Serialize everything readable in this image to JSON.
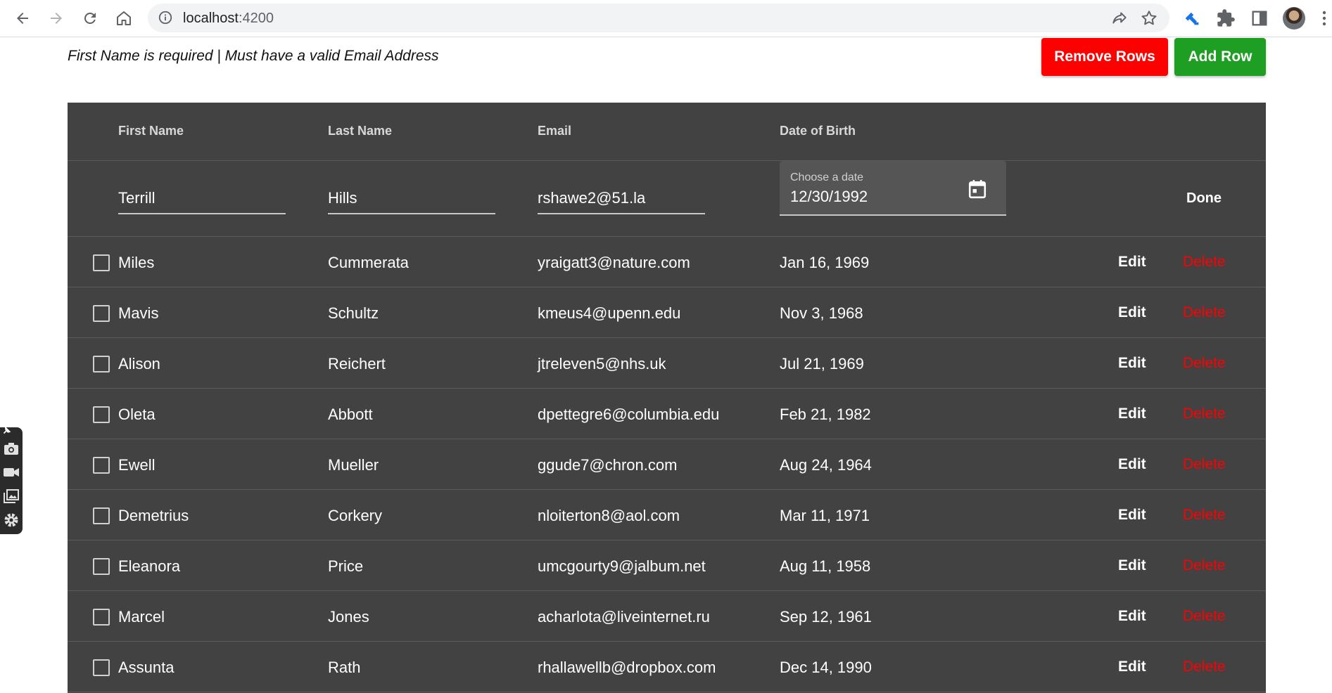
{
  "browser": {
    "url_host": "localhost",
    "url_port": ":4200"
  },
  "page": {
    "validation_message": "First Name is required | Must have a valid Email Address",
    "remove_rows_label": "Remove Rows",
    "add_row_label": "Add Row"
  },
  "table": {
    "headers": {
      "first_name": "First Name",
      "last_name": "Last Name",
      "email": "Email",
      "dob": "Date of Birth"
    },
    "edit_row": {
      "first_name": "Terrill",
      "last_name": "Hills",
      "email": "rshawe2@51.la",
      "date_label": "Choose a date",
      "date_value": "12/30/1992",
      "done_label": "Done"
    },
    "edit_label": "Edit",
    "delete_label": "Delete",
    "rows": [
      {
        "first": "Miles",
        "last": "Cummerata",
        "email": "yraigatt3@nature.com",
        "dob": "Jan 16, 1969"
      },
      {
        "first": "Mavis",
        "last": "Schultz",
        "email": "kmeus4@upenn.edu",
        "dob": "Nov 3, 1968"
      },
      {
        "first": "Alison",
        "last": "Reichert",
        "email": "jtreleven5@nhs.uk",
        "dob": "Jul 21, 1969"
      },
      {
        "first": "Oleta",
        "last": "Abbott",
        "email": "dpettegre6@columbia.edu",
        "dob": "Feb 21, 1982"
      },
      {
        "first": "Ewell",
        "last": "Mueller",
        "email": "ggude7@chron.com",
        "dob": "Aug 24, 1964"
      },
      {
        "first": "Demetrius",
        "last": "Corkery",
        "email": "nloiterton8@aol.com",
        "dob": "Mar 11, 1971"
      },
      {
        "first": "Eleanora",
        "last": "Price",
        "email": "umcgourty9@jalbum.net",
        "dob": "Aug 11, 1958"
      },
      {
        "first": "Marcel",
        "last": "Jones",
        "email": "acharlota@liveinternet.ru",
        "dob": "Sep 12, 1961"
      },
      {
        "first": "Assunta",
        "last": "Rath",
        "email": "rhallawellb@dropbox.com",
        "dob": "Dec 14, 1990"
      }
    ]
  },
  "colors": {
    "remove_button": "#ff0000",
    "add_button": "#1e9e22",
    "table_background": "#424242",
    "delete_text": "#ff0000"
  },
  "icons": [
    "back-icon",
    "forward-icon",
    "reload-icon",
    "home-icon",
    "info-icon",
    "share-icon",
    "star-icon",
    "extension-pin-icon",
    "puzzle-icon",
    "side-panel-icon",
    "calendar-icon",
    "camera-icon",
    "video-icon",
    "gallery-icon",
    "settings-icon"
  ]
}
